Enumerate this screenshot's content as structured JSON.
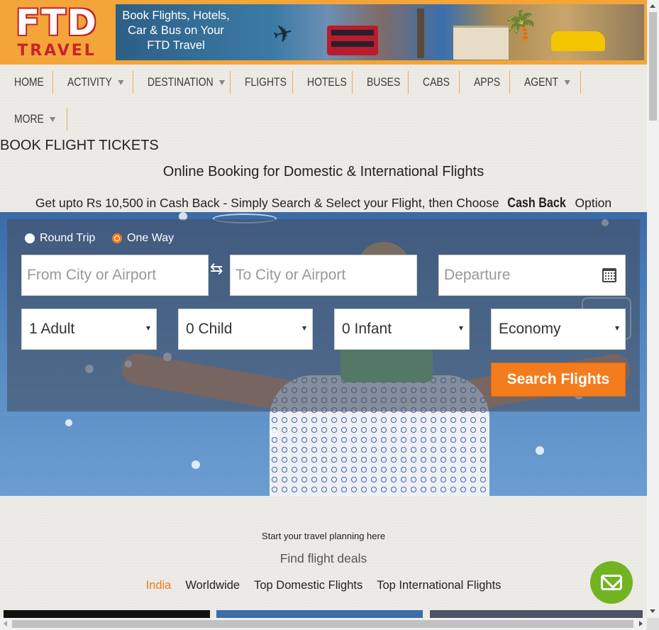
{
  "logo": {
    "line1": "FTD",
    "line2": "TRAVEL"
  },
  "banner": {
    "text": "Book Flights, Hotels, Car & Bus on Your FTD Travel"
  },
  "nav": [
    {
      "label": "HOME",
      "dropdown": false
    },
    {
      "label": "ACTIVITY",
      "dropdown": true
    },
    {
      "label": "DESTINATION",
      "dropdown": true
    },
    {
      "label": "FLIGHTS",
      "dropdown": false
    },
    {
      "label": "HOTELS",
      "dropdown": false
    },
    {
      "label": "BUSES",
      "dropdown": false
    },
    {
      "label": "CABS",
      "dropdown": false
    },
    {
      "label": "APPS",
      "dropdown": false
    },
    {
      "label": "AGENT",
      "dropdown": true
    },
    {
      "label": "MORE",
      "dropdown": true
    }
  ],
  "page": {
    "title": "BOOK FLIGHT TICKETS",
    "subtitle": "Online Booking for Domestic & International Flights",
    "cashback_prefix": "Get upto Rs 10,500 in Cash Back - Simply Search & Select your Flight, then Choose ",
    "cashback_bold": "Cash Back",
    "cashback_suffix": " Option"
  },
  "form": {
    "trip_types": [
      {
        "label": "Round Trip",
        "selected": false
      },
      {
        "label": "One Way",
        "selected": true
      }
    ],
    "from_placeholder": "From City or Airport",
    "to_placeholder": "To City or Airport",
    "departure_placeholder": "Departure",
    "adults": "1 Adult",
    "children": "0 Child",
    "infants": "0 Infant",
    "cabin_class": "Economy",
    "search_label": "Search Flights",
    "swap_icon": "⇆"
  },
  "deals": {
    "planning": "Start your travel planning here",
    "heading": "Find flight deals",
    "tabs": [
      {
        "label": "India",
        "active": true
      },
      {
        "label": "Worldwide",
        "active": false
      },
      {
        "label": "Top Domestic Flights",
        "active": false
      },
      {
        "label": "Top International Flights",
        "active": false
      }
    ]
  },
  "colors": {
    "accent": "#f37c1c",
    "header": "#f3a53a",
    "brand_red": "#c9232a",
    "chat": "#72b322"
  },
  "icons": {
    "calendar": "calendar-icon",
    "chat": "mail-icon",
    "swap": "swap-icon"
  }
}
